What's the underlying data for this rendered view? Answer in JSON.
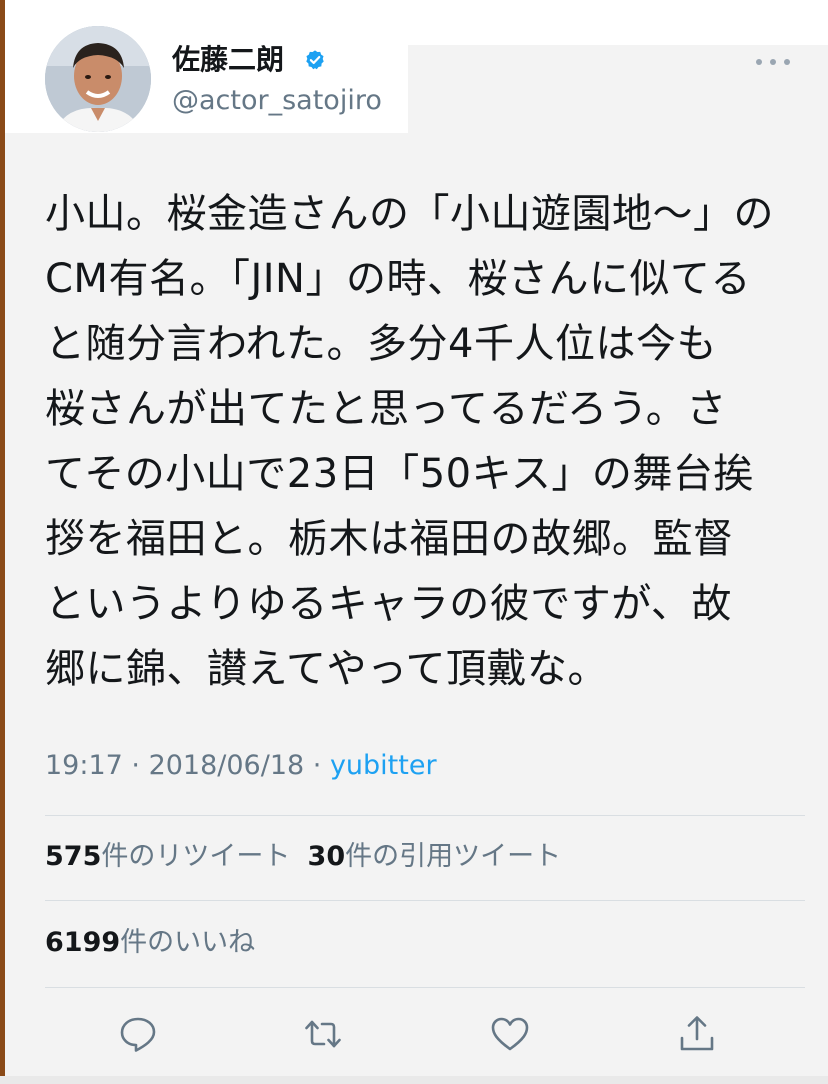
{
  "tweet": {
    "display_name": "佐藤二朗",
    "username": "@actor_satojiro",
    "verified_icon": "verified-badge-icon",
    "more_icon": "more-options-icon",
    "text": "小山。桜金造さんの「小山遊園地〜」の\nCM有名。「JIN」の時、桜さんに似てる\nと随分言われた。多分4千人位は今も\n桜さんが出てたと思ってるだろう。さ\nてその小山で23日「50キス」の舞台挨\n拶を福田と。栃木は福田の故郷。監督\nというよりゆるキャラの彼ですが、故\n郷に錦、讃えてやって頂戴な。",
    "time": "19:17",
    "separator": " · ",
    "date": "2018/06/18",
    "source": "yubitter"
  },
  "stats": {
    "retweets_count": "575",
    "retweets_label": "件のリツイート",
    "quotes_count": "30",
    "quotes_label": "件の引用ツイート",
    "likes_count": "6199",
    "likes_label": "件のいいね"
  },
  "actions": {
    "reply_icon": "reply-icon",
    "retweet_icon": "retweet-icon",
    "like_icon": "heart-icon",
    "share_icon": "share-icon"
  },
  "colors": {
    "accent": "#1da1f2",
    "secondary_text": "#657786",
    "primary_text": "#14171a",
    "background": "#f3f3f3"
  }
}
